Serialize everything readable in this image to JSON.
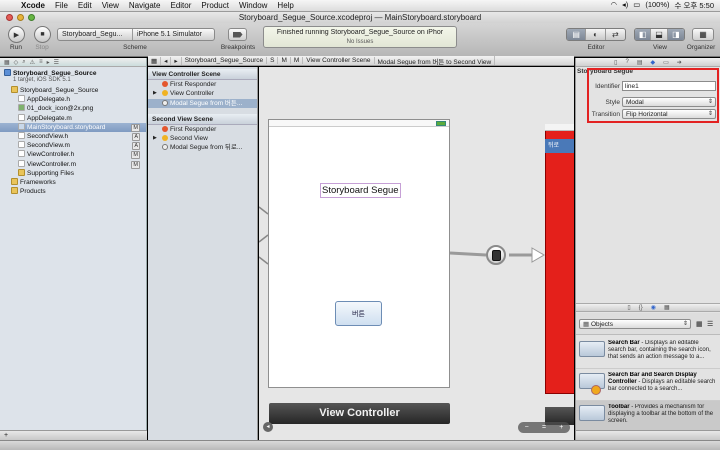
{
  "menubar": {
    "apple": "",
    "items": [
      "Xcode",
      "File",
      "Edit",
      "View",
      "Navigate",
      "Editor",
      "Product",
      "Window",
      "Help"
    ],
    "status": {
      "battery": "(100%)",
      "clock": "수 오후 5:50"
    }
  },
  "window": {
    "title": "Storyboard_Segue_Source.xcodeproj — MainStoryboard.storyboard"
  },
  "toolbar": {
    "run_label": "Run",
    "stop_label": "Stop",
    "scheme_target": "Storyboard_Segu...",
    "scheme_device": "iPhone 5.1 Simulator",
    "scheme_label": "Scheme",
    "breakpoints_label": "Breakpoints",
    "activity_line1": "Finished running Storyboard_Segue_Source on iPhor",
    "activity_line2": "No Issues",
    "editor_label": "Editor",
    "view_label": "View",
    "organizer_label": "Organizer"
  },
  "navigator": {
    "items": [
      {
        "label": "Storyboard_Segue_Source",
        "sub": "1 target, iOS SDK 5.1",
        "kind": "project",
        "level": 0
      },
      {
        "label": "Storyboard_Segue_Source",
        "kind": "folder",
        "level": 1
      },
      {
        "label": "AppDelegate.h",
        "kind": "h",
        "level": 2
      },
      {
        "label": "01_dock_icon@2x.png",
        "kind": "img",
        "level": 2
      },
      {
        "label": "AppDelegate.m",
        "kind": "m",
        "level": 2
      },
      {
        "label": "MainStoryboard.storyboard",
        "kind": "sb",
        "level": 2,
        "badge": "M",
        "selected": true
      },
      {
        "label": "SecondView.h",
        "kind": "h",
        "level": 2,
        "badge": "A"
      },
      {
        "label": "SecondView.m",
        "kind": "m",
        "level": 2,
        "badge": "A"
      },
      {
        "label": "ViewController.h",
        "kind": "h",
        "level": 2,
        "badge": "M"
      },
      {
        "label": "ViewController.m",
        "kind": "m",
        "level": 2,
        "badge": "M"
      },
      {
        "label": "Supporting Files",
        "kind": "folder",
        "level": 2
      },
      {
        "label": "Frameworks",
        "kind": "folder",
        "level": 1
      },
      {
        "label": "Products",
        "kind": "folder",
        "level": 1
      }
    ]
  },
  "jumpbar": [
    "Storyboard_Segue_Source",
    "S",
    "M",
    "M",
    "View Controller Scene",
    "Modal Segue from 버튼 to Second View"
  ],
  "outline": {
    "scene1": {
      "title": "View Controller Scene",
      "rows": [
        "First Responder",
        "View Controller",
        "Modal Segue from 버튼..."
      ]
    },
    "scene2": {
      "title": "Second View Scene",
      "rows": [
        "First Responder",
        "Second View",
        "Modal Segue from 뒤로..."
      ]
    }
  },
  "canvas": {
    "label_text": "Storyboard Segue",
    "button_text": "버튼",
    "vc_title": "View Controller",
    "red_button": "뒤로"
  },
  "inspector": {
    "section": "Storyboard Segue",
    "identifier_label": "Identifier",
    "identifier_value": "line1",
    "style_label": "Style",
    "style_value": "Modal",
    "transition_label": "Transition",
    "transition_value": "Flip Horizontal"
  },
  "library": {
    "filter": "Objects",
    "items": [
      {
        "title": "Search Bar",
        "desc": " - Displays an editable search bar, containing the search icon, that sends an action message to a..."
      },
      {
        "title": "Search Bar and Search Display Controller",
        "desc": " - Displays an editable search bar connected to a search..."
      },
      {
        "title": "Toolbar",
        "desc": " - Provides a mechanism for displaying a toolbar at the bottom of the screen."
      }
    ]
  },
  "colors": {
    "accent_red": "#e32222",
    "canvas_red": "#e4201b",
    "selection": "#7f9bc1"
  }
}
